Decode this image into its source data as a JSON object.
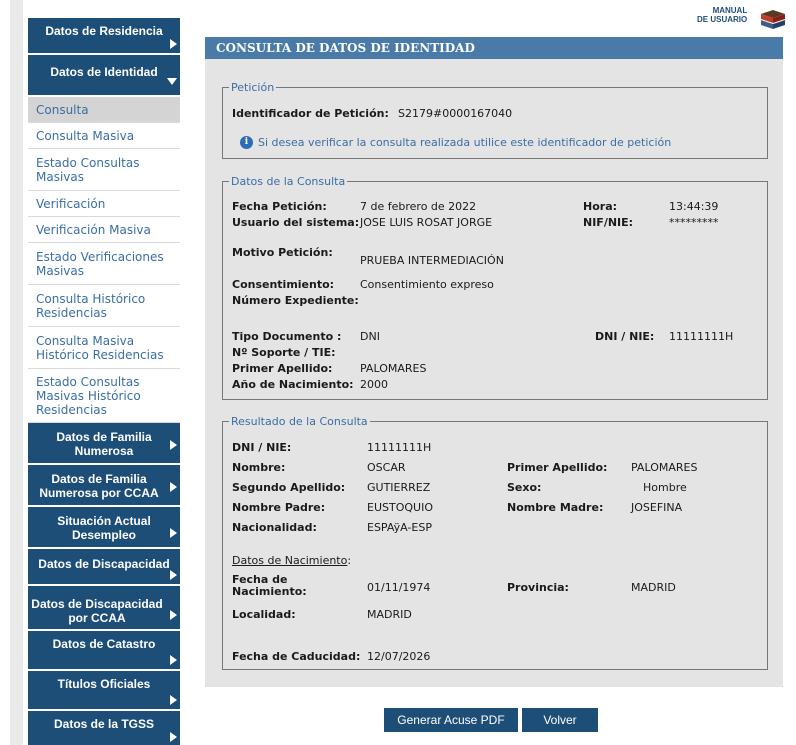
{
  "sidebar": {
    "residencia": "Datos de Residencia",
    "identidad": "Datos de Identidad",
    "links": [
      {
        "label": "Consulta"
      },
      {
        "label": "Consulta Masiva"
      },
      {
        "label": "Estado Consultas Masivas"
      },
      {
        "label": "Verificación"
      },
      {
        "label": "Verificación Masiva"
      },
      {
        "label": "Estado Verificaciones Masivas"
      },
      {
        "label": "Consulta Histórico Residencias"
      },
      {
        "label": "Consulta Masiva Histórico Residencias"
      },
      {
        "label": "Estado Consultas Masivas Histórico Residencias"
      }
    ],
    "bottom": [
      {
        "label": "Datos de Familia Numerosa"
      },
      {
        "label": "Datos de Familia Numerosa por CCAA"
      },
      {
        "label": "Situación Actual Desempleo"
      },
      {
        "label": "Datos de Discapacidad"
      },
      {
        "label": "Datos de Discapacidad por CCAA"
      },
      {
        "label": "Datos de Catastro"
      },
      {
        "label": "Títulos Oficiales"
      },
      {
        "label": "Datos de la TGSS"
      }
    ]
  },
  "manual": {
    "line1": "MANUAL",
    "line2": "DE USUARIO"
  },
  "main": {
    "title": "CONSULTA DE DATOS DE IDENTIDAD",
    "peticion": {
      "legend": "Petición",
      "id_label": "Identificador de Petición:",
      "id_value": "S2179#0000167040",
      "info": "Si desea verificar la consulta realizada utilice este identificador de petición"
    },
    "consulta": {
      "legend": "Datos de la Consulta",
      "fecha_label": "Fecha Petición:",
      "fecha_value": "7 de febrero de 2022",
      "hora_label": "Hora:",
      "hora_value": "13:44:39",
      "usuario_label": "Usuario del sistema:",
      "usuario_value": "JOSE LUIS ROSAT JORGE",
      "nif_label": "NIF/NIE:",
      "nif_value": "*********",
      "motivo_label": "Motivo Petición:",
      "motivo_value": "PRUEBA INTERMEDIACIÓN",
      "consent_label": "Consentimiento:",
      "consent_value": "Consentimiento expreso",
      "expediente_label": "Número Expediente:",
      "tipo_label": "Tipo Documento :",
      "tipo_value": "DNI",
      "dni_label": "DNI / NIE:",
      "dni_value": "11111111H",
      "soporte_label": "Nº Soporte / TIE:",
      "apellido_label": "Primer Apellido:",
      "apellido_value": "PALOMARES",
      "anio_label": "Año de Nacimiento:",
      "anio_value": "2000"
    },
    "resultado": {
      "legend": "Resultado de la Consulta",
      "dni_label": "DNI / NIE:",
      "dni_value": "11111111H",
      "nombre_label": "Nombre:",
      "nombre_value": "OSCAR",
      "ap1_label": "Primer Apellido:",
      "ap1_value": "PALOMARES",
      "ap2_label": "Segundo Apellido:",
      "ap2_value": "GUTIERREZ",
      "sexo_label": "Sexo:",
      "sexo_value": "Hombre",
      "padre_label": "Nombre Padre:",
      "padre_value": "EUSTOQUIO",
      "madre_label": "Nombre Madre:",
      "madre_value": "JOSEFINA",
      "nac_label": "Nacionalidad:",
      "nac_value": "ESPAÿA-ESP",
      "datos_nac": "Datos de Nacimiento",
      "datos_nac_colon": ":",
      "fnac_label1": "Fecha de",
      "fnac_label2": "Nacimiento:",
      "fnac_value": "01/11/1974",
      "prov_label": "Provincia:",
      "prov_value": "MADRID",
      "loc_label": "Localidad:",
      "loc_value": "MADRID",
      "cad_label": "Fecha de Caducidad:",
      "cad_value": "12/07/2026"
    }
  },
  "buttons": {
    "pdf": "Generar Acuse PDF",
    "volver": "Volver"
  }
}
